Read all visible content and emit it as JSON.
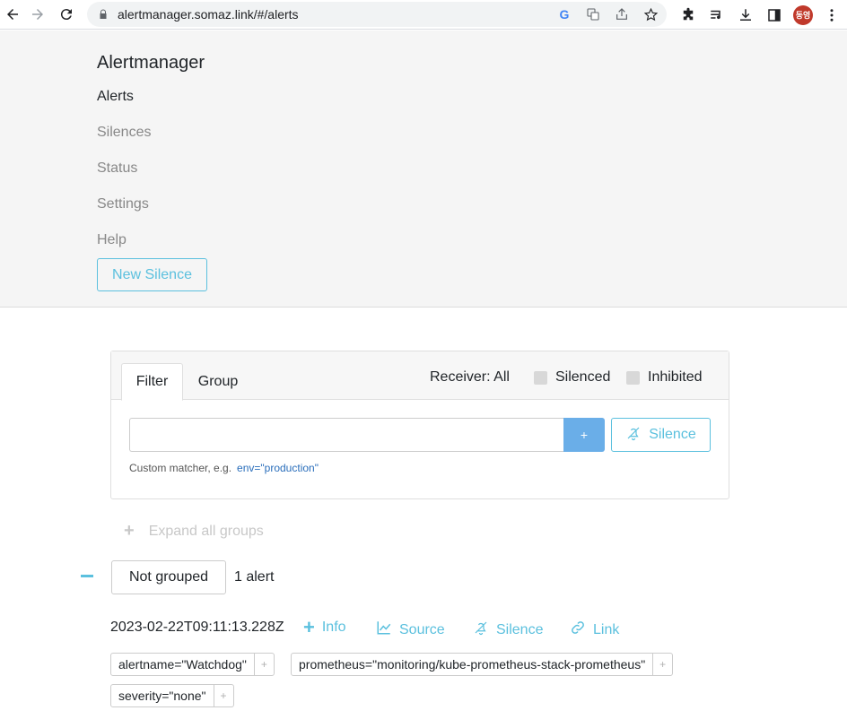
{
  "browser": {
    "url": "alertmanager.somaz.link/#/alerts",
    "profile_initials": "동영"
  },
  "nav": {
    "brand": "Alertmanager",
    "links": [
      "Alerts",
      "Silences",
      "Status",
      "Settings",
      "Help"
    ],
    "new_silence": "New Silence"
  },
  "filter_card": {
    "tabs": [
      "Filter",
      "Group"
    ],
    "receiver": "Receiver: All",
    "silenced_label": "Silenced",
    "inhibited_label": "Inhibited",
    "matcher_value": "",
    "add_button": "+",
    "silence_button": "Silence",
    "hint_text": "Custom matcher, e.g.",
    "hint_example": "env=\"production\""
  },
  "expand_all": "Expand all groups",
  "group": {
    "label": "Not grouped",
    "count": "1 alert"
  },
  "alert": {
    "timestamp": "2023-02-22T09:11:13.228Z",
    "actions": {
      "info": "Info",
      "source": "Source",
      "silence": "Silence",
      "link": "Link"
    },
    "labels": [
      "alertname=\"Watchdog\"",
      "prometheus=\"monitoring/kube-prometheus-stack-prometheus\"",
      "severity=\"none\""
    ],
    "label_add": "+"
  },
  "colors": {
    "accent": "#5bc0de",
    "primary_button": "#6aaee8",
    "nav_background": "#f5f5f5"
  }
}
